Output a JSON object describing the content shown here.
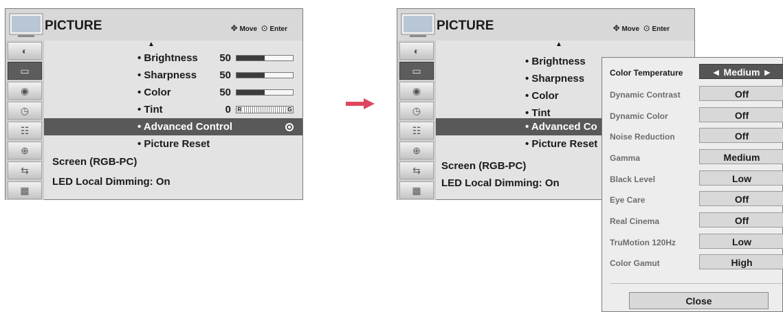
{
  "header": {
    "title": "PICTURE",
    "move_label": "Move",
    "enter_label": "Enter"
  },
  "sidebar": {
    "icons": [
      "picture-icon",
      "screen-icon",
      "audio-icon",
      "clock-icon",
      "option-icon",
      "lock-icon",
      "input-icon",
      "usb-icon"
    ],
    "selected_index": 1
  },
  "menu": {
    "items": [
      {
        "label": "• Brightness",
        "value": "50",
        "level": 0.5
      },
      {
        "label": "• Sharpness",
        "value": "50",
        "level": 0.5
      },
      {
        "label": "• Color",
        "value": "50",
        "level": 0.5
      },
      {
        "label": "• Tint",
        "value": "0",
        "left_letter": "R",
        "right_letter": "G"
      },
      {
        "label": "• Advanced Control"
      },
      {
        "label": "• Picture Reset"
      }
    ],
    "right_labels": [
      "• Brightness",
      "• Sharpness",
      "• Color",
      "• Tint",
      "• Advanced Co",
      "• Picture Reset"
    ],
    "screen_label": "Screen (RGB-PC)",
    "led_label": "LED Local Dimming: On"
  },
  "popup": {
    "rows": [
      {
        "label": "Color Temperature",
        "value": "Medium",
        "selected": true,
        "left_arrow": "◄",
        "right_arrow": "►"
      },
      {
        "label": "Dynamic Contrast",
        "value": "Off"
      },
      {
        "label": "Dynamic Color",
        "value": "Off"
      },
      {
        "label": "Noise Reduction",
        "value": "Off"
      },
      {
        "label": "Gamma",
        "value": "Medium"
      },
      {
        "label": "Black Level",
        "value": "Low"
      },
      {
        "label": "Eye Care",
        "value": "Off"
      },
      {
        "label": "Real Cinema",
        "value": "Off"
      },
      {
        "label": "TruMotion 120Hz",
        "value": "Low"
      },
      {
        "label": "Color Gamut",
        "value": "High"
      }
    ],
    "close_label": "Close"
  },
  "colors": {
    "highlight": "#595959",
    "panel": "#e3e3e3",
    "arrow": "#e0455f"
  }
}
